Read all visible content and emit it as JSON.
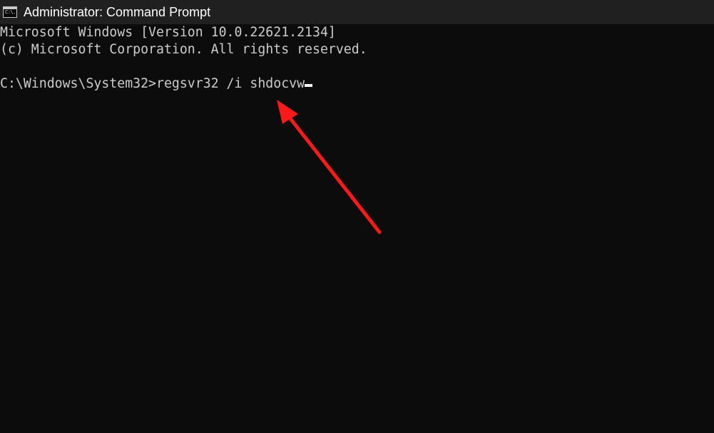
{
  "window": {
    "title": "Administrator: Command Prompt",
    "icon": "command-prompt-icon",
    "icon_text": "C:\\."
  },
  "console": {
    "lines": [
      "Microsoft Windows [Version 10.0.22621.2134]",
      "(c) Microsoft Corporation. All rights reserved.",
      ""
    ],
    "prompt": "C:\\Windows\\System32>",
    "command": "regsvr32 /i shdocvw"
  },
  "annotation": {
    "type": "arrow",
    "color": "#ff1a1a"
  },
  "colors": {
    "titlebar": "#202020",
    "console_background": "#0c0c0c",
    "console_text": "#cccccc"
  }
}
